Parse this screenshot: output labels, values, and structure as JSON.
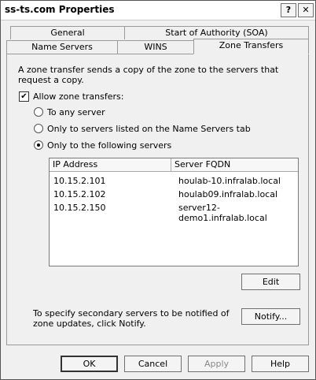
{
  "window": {
    "title": "ss-ts.com Properties",
    "help_btn": "?",
    "close_btn": "✕"
  },
  "tabs_row1": [
    {
      "label": "General"
    },
    {
      "label": "Start of Authority (SOA)"
    }
  ],
  "tabs_row2": [
    {
      "label": "Name Servers"
    },
    {
      "label": "WINS"
    },
    {
      "label": "Zone Transfers",
      "active": true
    }
  ],
  "content": {
    "description": "A zone transfer sends a copy of the zone to the servers that request a copy.",
    "allow_label": "Allow zone transfers:",
    "allow_checked": true,
    "options": [
      {
        "label": "To any server",
        "selected": false
      },
      {
        "label": "Only to servers listed on the Name Servers tab",
        "selected": false
      },
      {
        "label": "Only to the following servers",
        "selected": true
      }
    ],
    "table": {
      "columns": [
        "IP Address",
        "Server FQDN"
      ],
      "rows": [
        {
          "ip": "10.15.2.101",
          "fqdn": "houlab-10.infralab.local"
        },
        {
          "ip": "10.15.2.102",
          "fqdn": "houlab09.infralab.local"
        },
        {
          "ip": "10.15.2.150",
          "fqdn": "server12-demo1.infralab.local"
        }
      ]
    },
    "edit_btn": "Edit",
    "notify_text": "To specify secondary servers to be notified of zone updates, click Notify.",
    "notify_btn": "Notify..."
  },
  "footer": {
    "ok": "OK",
    "cancel": "Cancel",
    "apply": "Apply",
    "help": "Help"
  }
}
